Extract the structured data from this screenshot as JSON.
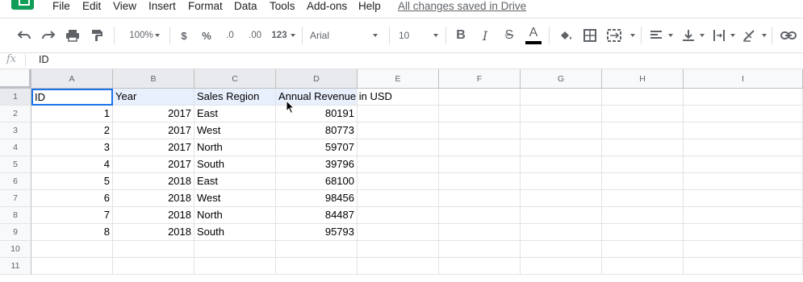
{
  "menu": {
    "items": [
      "File",
      "Edit",
      "View",
      "Insert",
      "Format",
      "Data",
      "Tools",
      "Add-ons",
      "Help"
    ],
    "saved_status": "All changes saved in Drive"
  },
  "toolbar": {
    "zoom": "100%",
    "currency": "$",
    "percent": "%",
    "decrease_decimals": ".0",
    "increase_decimals": ".00",
    "more_formats": "123",
    "font": "Arial",
    "font_size": "10",
    "bold": "B",
    "italic": "I",
    "strikethrough": "S",
    "text_color": "A",
    "text_color_swatch": "#000000"
  },
  "formula_bar": {
    "fx_label": "fx",
    "value": "ID"
  },
  "columns": [
    "A",
    "B",
    "C",
    "D",
    "E",
    "F",
    "G",
    "H",
    "I"
  ],
  "rows": [
    "1",
    "2",
    "3",
    "4",
    "5",
    "6",
    "7",
    "8",
    "9",
    "10",
    "11"
  ],
  "sheet": {
    "header": [
      "ID",
      "Year",
      "Sales Region",
      "Annual Revenue in USD"
    ],
    "data": [
      [
        "1",
        "2017",
        "East",
        "80191"
      ],
      [
        "2",
        "2017",
        "West",
        "80773"
      ],
      [
        "3",
        "2017",
        "North",
        "59707"
      ],
      [
        "4",
        "2017",
        "South",
        "39796"
      ],
      [
        "5",
        "2018",
        "East",
        "68100"
      ],
      [
        "6",
        "2018",
        "West",
        "98456"
      ],
      [
        "7",
        "2018",
        "North",
        "84487"
      ],
      [
        "8",
        "2018",
        "South",
        "95793"
      ]
    ]
  },
  "colors": {
    "selection_border": "#1a73e8",
    "selection_fill": "#e8f0fe",
    "brand": "#0f9d58"
  }
}
